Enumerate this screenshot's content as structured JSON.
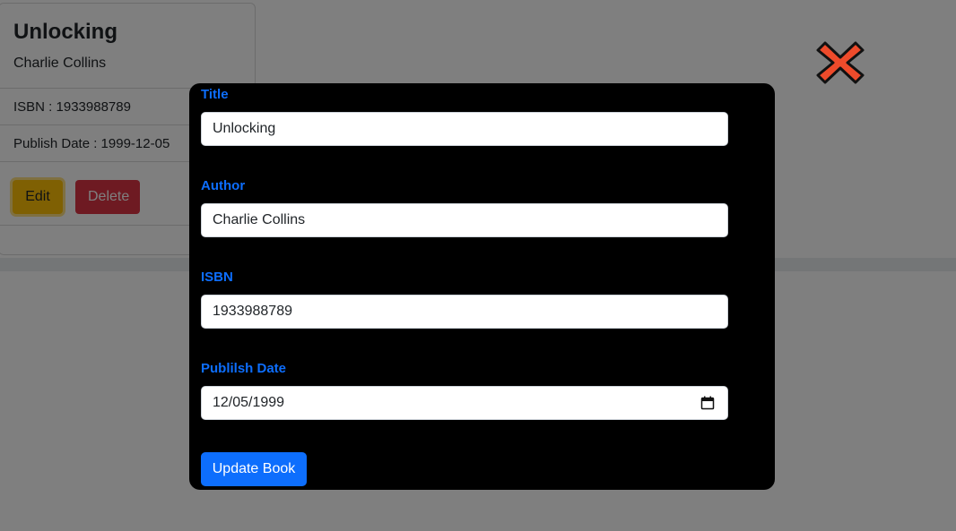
{
  "card": {
    "title": "Unlocking",
    "author": "Charlie Collins",
    "isbn_text": "ISBN : 1933988789",
    "publish_date_text": "Publish Date : 1999-12-05",
    "edit_label": "Edit",
    "delete_label": "Delete"
  },
  "modal": {
    "fields": [
      {
        "label": "Title",
        "value": "Unlocking"
      },
      {
        "label": "Author",
        "value": "Charlie Collins"
      },
      {
        "label": "ISBN",
        "value": "1933988789"
      },
      {
        "label": "Publilsh Date",
        "value": "12/05/1999"
      }
    ],
    "submit_label": "Update Book",
    "close_icon": "close-x-icon"
  },
  "colors": {
    "accent": "#0d6efd",
    "edit": "#ffc107",
    "delete": "#dc3545",
    "close": "#ee4b2b"
  }
}
